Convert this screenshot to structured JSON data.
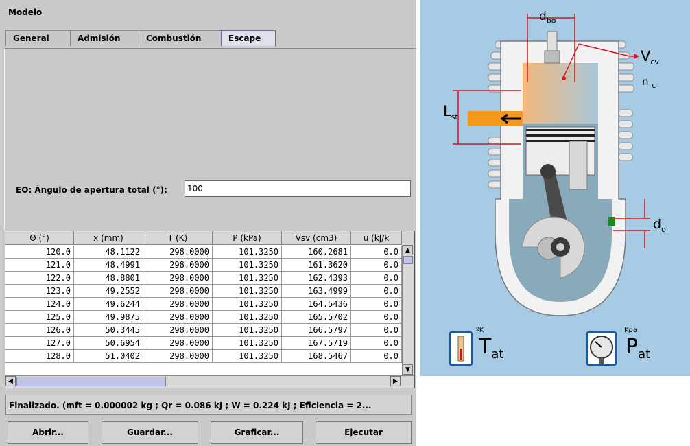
{
  "panel": {
    "title": "Modelo"
  },
  "tabs": [
    "General",
    "Admisión",
    "Combustión",
    "Escape"
  ],
  "active_tab": "Escape",
  "eo": {
    "label": "EO: Ángulo de apertura total (°):",
    "value": "100"
  },
  "table": {
    "columns": [
      "Θ (°)",
      "x (mm)",
      "T (K)",
      "P (kPa)",
      "Vsv (cm3)",
      "u (kJ/k"
    ],
    "rows": [
      [
        "120.0",
        "48.1122",
        "298.0000",
        "101.3250",
        "160.2681",
        "0.0"
      ],
      [
        "121.0",
        "48.4991",
        "298.0000",
        "101.3250",
        "161.3620",
        "0.0"
      ],
      [
        "122.0",
        "48.8801",
        "298.0000",
        "101.3250",
        "162.4393",
        "0.0"
      ],
      [
        "123.0",
        "49.2552",
        "298.0000",
        "101.3250",
        "163.4999",
        "0.0"
      ],
      [
        "124.0",
        "49.6244",
        "298.0000",
        "101.3250",
        "164.5436",
        "0.0"
      ],
      [
        "125.0",
        "49.9875",
        "298.0000",
        "101.3250",
        "165.5702",
        "0.0"
      ],
      [
        "126.0",
        "50.3445",
        "298.0000",
        "101.3250",
        "166.5797",
        "0.0"
      ],
      [
        "127.0",
        "50.6954",
        "298.0000",
        "101.3250",
        "167.5719",
        "0.0"
      ],
      [
        "128.0",
        "51.0402",
        "298.0000",
        "101.3250",
        "168.5467",
        "0.0"
      ]
    ]
  },
  "status": "Finalizado. (mft = 0.000002 kg ; Qr = 0.086 kJ ; W = 0.224 kJ ; Eficiencia = 2...",
  "buttons": {
    "open": "Abrir...",
    "save": "Guardar...",
    "plot": "Graficar...",
    "run": "Ejecutar"
  },
  "diagram": {
    "d_bo_main": "d",
    "d_bo_sub": "bo",
    "vcv_main": "V",
    "vcv_sub": "cv",
    "nc_main": "n",
    "nc_sub": "c",
    "lst_main": "L",
    "lst_sub": "st",
    "do_main": "d",
    "do_sub": "o",
    "tat_unit": "ºK",
    "tat_main": "T",
    "tat_sub": "at",
    "pat_unit": "Kpa",
    "pat_main": "P",
    "pat_sub": "at"
  },
  "colors": {
    "diagram_bg": "#a7cbe4",
    "dimension_line": "#d8141c",
    "exhaust": "#f39a1e",
    "cylinder": "#f2f2f2"
  }
}
